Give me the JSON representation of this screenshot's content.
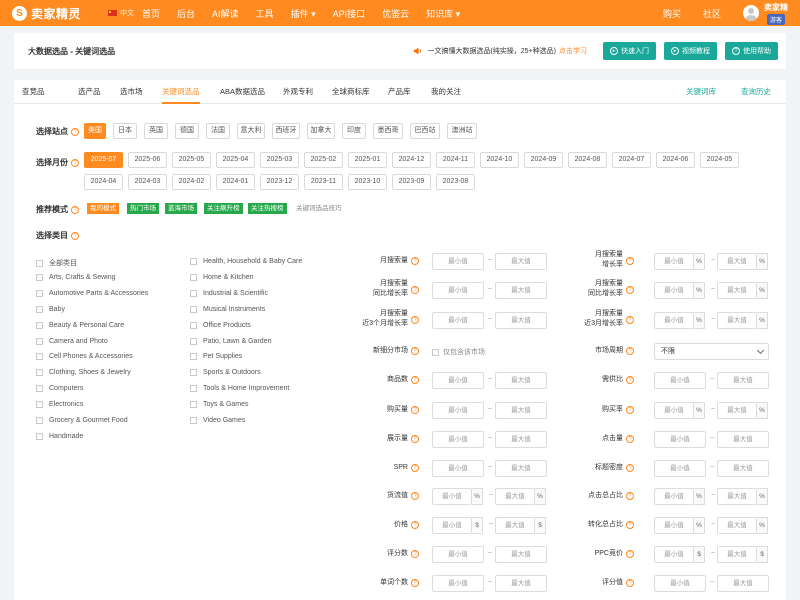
{
  "topbar": {
    "logo_mark": "S",
    "logo_text": "卖家精灵",
    "lang": "中文",
    "nav": [
      "首页",
      "后台",
      "AI解读",
      "工具",
      "插件",
      "API接口",
      "优鉴云",
      "知识库"
    ],
    "nav_right": [
      "购买",
      "社区"
    ],
    "user_name": "卖家精",
    "user_badge": "游客"
  },
  "header": {
    "title": "大数据选品 - 关键词选品",
    "notice": "一文搞懂大数据选品(纯实操，25+种选品)",
    "notice_link": "点击学习",
    "buttons": [
      {
        "label": "快速入门"
      },
      {
        "label": "视频教程"
      },
      {
        "label": "使用帮助"
      }
    ]
  },
  "tabs": {
    "items": [
      "查竞品",
      "选产品",
      "选市场",
      "关键词选品",
      "ABA数据选品",
      "外观专利",
      "全球商标库",
      "产品库",
      "我的关注"
    ],
    "active": "关键词选品",
    "right": [
      "关键词库",
      "查询历史"
    ]
  },
  "station": {
    "label": "选择站点",
    "options": [
      "美国",
      "日本",
      "英国",
      "德国",
      "法国",
      "意大利",
      "西班牙",
      "加拿大",
      "印度",
      "墨西哥",
      "巴西站",
      "澳洲站"
    ],
    "selected": "美国"
  },
  "month": {
    "label": "选择月份",
    "row1": [
      "2025-07",
      "2025-06",
      "2025-05",
      "2025-04",
      "2025-03",
      "2025-02",
      "2025-01",
      "2024-12",
      "2024-11",
      "2024-10",
      "2024-09",
      "2024-08",
      "2024-07",
      "2024-06",
      "2024-05"
    ],
    "row2": [
      "2024-04",
      "2024-03",
      "2024-02",
      "2024-01",
      "2023-12",
      "2023-11",
      "2023-10",
      "2023-09",
      "2023-08"
    ],
    "selected": "2025-07"
  },
  "mode": {
    "label": "推荐模式",
    "items": [
      "我的模式",
      "热门市场",
      "蓝海市场",
      "关注飙升榜",
      "关注热搜榜",
      "关键词选品技巧"
    ]
  },
  "category": {
    "label": "选择类目",
    "col1": [
      "全部类目",
      "Arts, Crafts & Sewing",
      "Automotive Parts & Accessories",
      "Baby",
      "Beauty & Personal Care",
      "Camera and Photo",
      "Cell Phones & Accessories",
      "Clothing, Shoes & Jewelry",
      "Computers",
      "Electronics",
      "Grocery & Gourmet Food",
      "Handmade"
    ],
    "col2": [
      "Health, Household & Baby Care",
      "Home & Kitchen",
      "Industrial & Scientific",
      "Musical Instruments",
      "Office Products",
      "Patio, Lawn & Garden",
      "Pet Supplies",
      "Sports & Outdoors",
      "Tools & Home Improvement",
      "Toys & Games",
      "Video Games"
    ]
  },
  "filters": {
    "min": "最小值",
    "max": "最大值",
    "left": [
      {
        "label": "月搜索量"
      },
      {
        "label": "月搜索量\n同比增长率"
      },
      {
        "label": "月搜索量\n近3个月增长率"
      },
      {
        "label": "新细分市场"
      },
      {
        "label": "商品数"
      },
      {
        "label": "购买量"
      },
      {
        "label": "展示量"
      },
      {
        "label": "SPR"
      },
      {
        "label": "货流值"
      },
      {
        "label": "价格"
      },
      {
        "label": "评分数"
      },
      {
        "label": "单词个数"
      }
    ],
    "right": [
      {
        "label": "月搜索量\n增长率"
      },
      {
        "label": "月搜索量\n同比增长率"
      },
      {
        "label": "月搜索量\n近3月增长率"
      },
      {
        "label": "市场周期"
      },
      {
        "label": "需供比"
      },
      {
        "label": "购买率"
      },
      {
        "label": "点击量"
      },
      {
        "label": "标题密度"
      },
      {
        "label": "点击总占比"
      },
      {
        "label": "转化总占比"
      },
      {
        "label": "PPC竞价"
      },
      {
        "label": "评分值"
      }
    ],
    "only_related": "仅包含该市场",
    "market_cycle": "不限",
    "percent": "%",
    "dollar": "$",
    "dash": "~"
  }
}
